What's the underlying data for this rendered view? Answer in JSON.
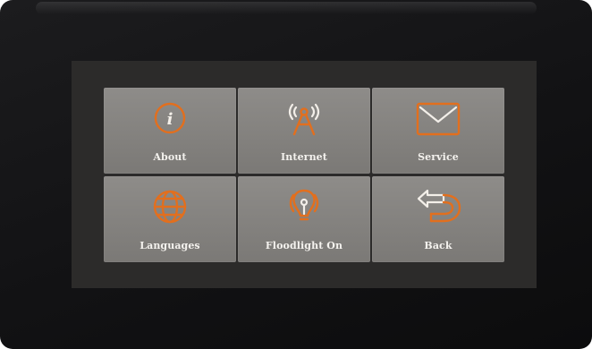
{
  "menu": {
    "tiles": [
      {
        "label": "About",
        "icon": "info-icon"
      },
      {
        "label": "Internet",
        "icon": "antenna-icon"
      },
      {
        "label": "Service",
        "icon": "envelope-icon"
      },
      {
        "label": "Languages",
        "icon": "globe-icon"
      },
      {
        "label": "Floodlight On",
        "icon": "floodlight-icon"
      },
      {
        "label": "Back",
        "icon": "back-arrow-icon"
      }
    ]
  },
  "colors": {
    "accent": "#e26f1e",
    "tile": "#84827f",
    "screen_background": "#2c2b2a",
    "bezel": "#141416",
    "label": "#f4f2ee"
  }
}
